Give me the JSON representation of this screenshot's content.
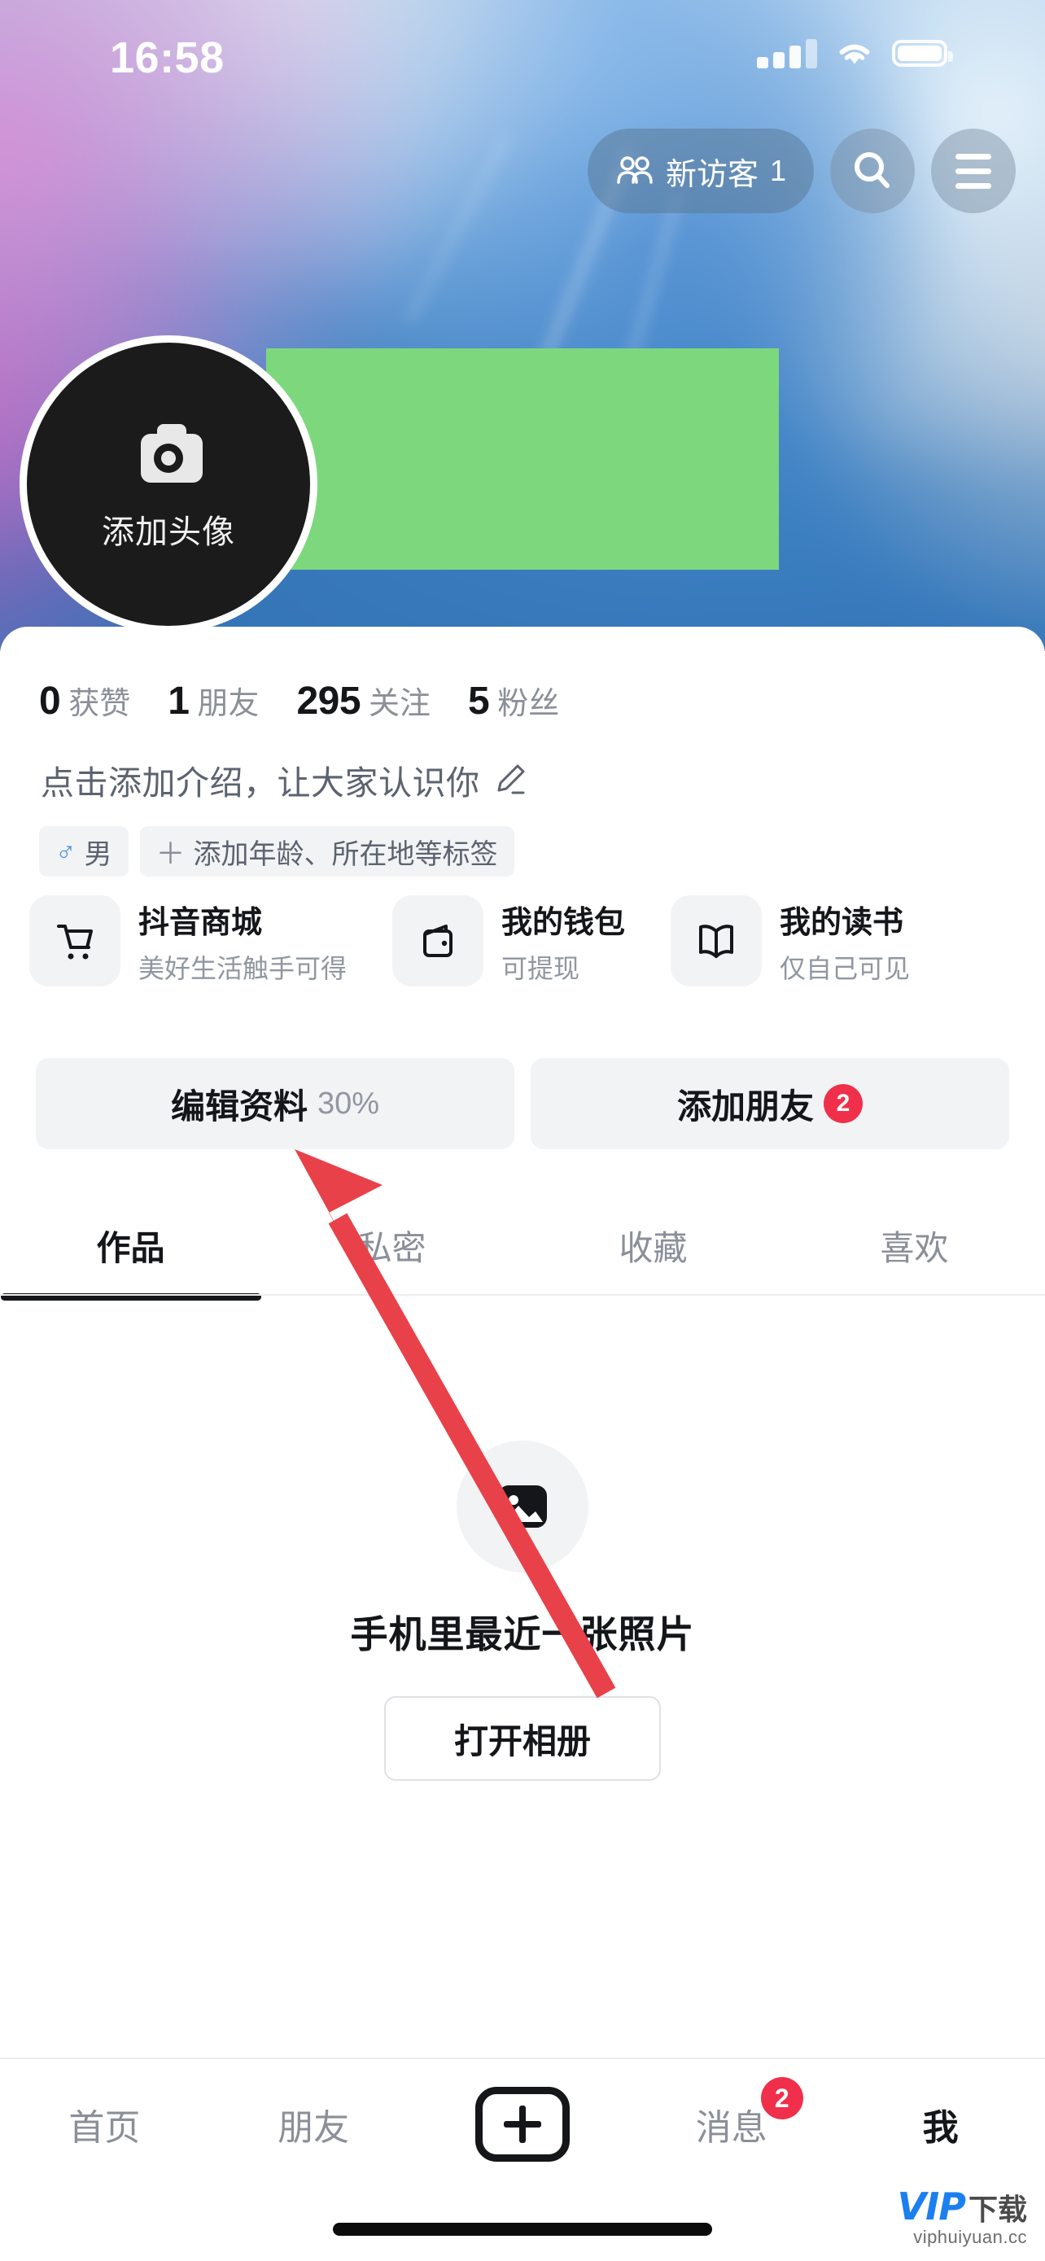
{
  "status_bar": {
    "time": "16:58",
    "signal_icon": "cellular-signal-icon",
    "wifi_icon": "wifi-icon",
    "battery_icon": "battery-icon"
  },
  "top_bar": {
    "visitor_chip": {
      "icon": "people-icon",
      "label": "新访客",
      "count": "1"
    },
    "search_icon": "search-icon",
    "menu_icon": "hamburger-menu-icon"
  },
  "profile": {
    "avatar": {
      "icon": "camera-icon",
      "label": "添加头像"
    },
    "redaction_color": "#7dd87d",
    "stats": [
      {
        "num": "0",
        "label": "获赞"
      },
      {
        "num": "1",
        "label": "朋友"
      },
      {
        "num": "295",
        "label": "关注"
      },
      {
        "num": "5",
        "label": "粉丝"
      }
    ],
    "bio": {
      "text": "点击添加介绍，让大家认识你",
      "edit_icon": "pencil-icon"
    },
    "tags": [
      {
        "icon": "male-gender-icon",
        "symbol": "♂",
        "label": "男"
      },
      {
        "icon": "plus-icon",
        "symbol": "＋",
        "label": "添加年龄、所在地等标签"
      }
    ]
  },
  "service_cards": [
    {
      "icon": "shopping-cart-icon",
      "title": "抖音商城",
      "subtitle": "美好生活触手可得"
    },
    {
      "icon": "wallet-icon",
      "title": "我的钱包",
      "subtitle": "可提现"
    },
    {
      "icon": "book-icon",
      "title": "我的读书",
      "subtitle": "仅自己可见"
    }
  ],
  "actions": {
    "edit_profile": {
      "label": "编辑资料",
      "percent": "30%"
    },
    "add_friend": {
      "label": "添加朋友",
      "badge": "2",
      "badge_color": "#f0304a"
    }
  },
  "tabs": [
    {
      "label": "作品",
      "active": true
    },
    {
      "label": "私密",
      "active": false
    },
    {
      "label": "收藏",
      "active": false
    },
    {
      "label": "喜欢",
      "active": false
    }
  ],
  "empty_state": {
    "icon": "image-placeholder-icon",
    "text": "手机里最近一张照片",
    "button_label": "打开相册"
  },
  "bottom_nav": [
    {
      "label": "首页",
      "active": false,
      "badge": ""
    },
    {
      "label": "朋友",
      "active": false,
      "badge": ""
    },
    {
      "label": "",
      "icon": "plus-create-icon",
      "active": false,
      "badge": ""
    },
    {
      "label": "消息",
      "active": false,
      "badge": "2"
    },
    {
      "label": "我",
      "active": true,
      "badge": ""
    }
  ],
  "annotation": {
    "arrow_icon": "red-arrow-pointer",
    "color": "#e8414a"
  },
  "watermark": {
    "brand": "VIP",
    "brand_cn": "下载",
    "url": "viphuiyuan.cc"
  }
}
